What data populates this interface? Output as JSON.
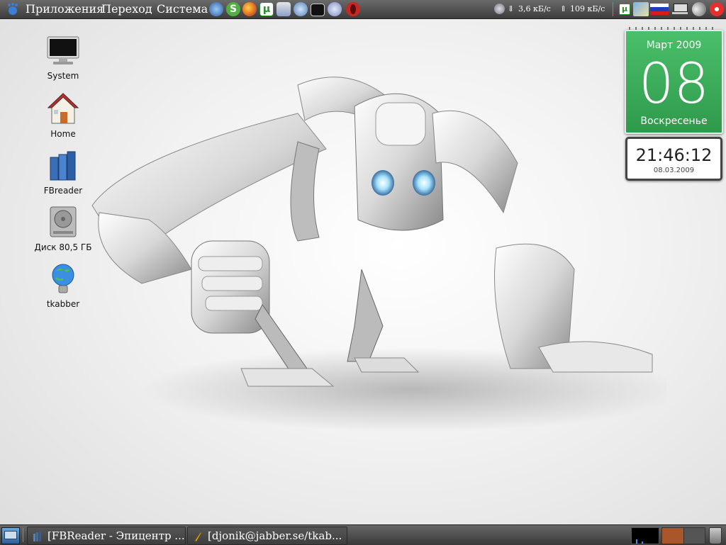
{
  "top_panel": {
    "menus": [
      "Приложения",
      "Переход",
      "Система"
    ],
    "launchers": [
      "thunderbird-icon",
      "skype-icon",
      "firefox-icon",
      "utorrent-icon",
      "filemanager-icon",
      "transmission-icon",
      "terminal-icon",
      "pidgin-icon",
      "opera-icon"
    ],
    "net_down": "3,6 кБ/с",
    "net_up": "109 кБ/с",
    "tray": [
      "utorrent-tray-icon",
      "flag-icon",
      "keyboard-layout-icon",
      "network-icon",
      "volume-icon",
      "update-icon"
    ]
  },
  "desktop": {
    "icons": [
      {
        "label": "System",
        "icon": "monitor-icon"
      },
      {
        "label": "Home",
        "icon": "home-icon"
      },
      {
        "label": "FBreader",
        "icon": "books-icon"
      },
      {
        "label": "Диск 80,5 ГБ",
        "icon": "harddisk-icon"
      },
      {
        "label": "tkabber",
        "icon": "bulb-icon"
      }
    ]
  },
  "calendar": {
    "month": "Март 2009",
    "day": "08",
    "weekday": "Воскресенье"
  },
  "clock": {
    "time": "21:46:12",
    "date": "08.03.2009"
  },
  "taskbar": {
    "tasks": [
      {
        "label": "[FBReader - Эпицентр ..."
      },
      {
        "label": "[djonik@jabber.se/tkab..."
      }
    ]
  },
  "colors": {
    "panel": "#4a4a4a",
    "calendar_green": "#3aab58"
  }
}
